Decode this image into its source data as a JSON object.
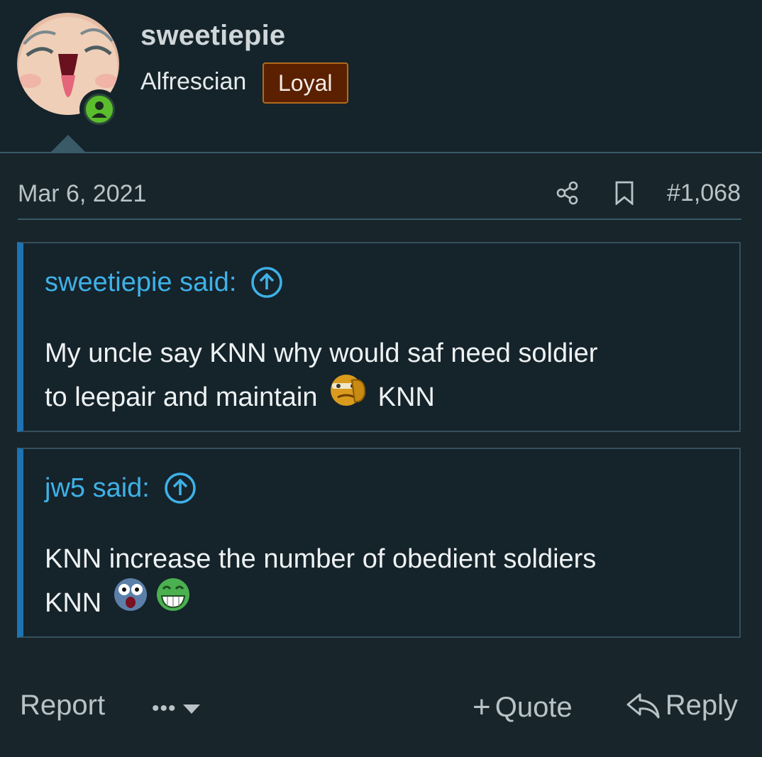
{
  "user": {
    "username": "sweetiepie",
    "title": "Alfrescian",
    "badge": "Loyal",
    "status": "online",
    "accent_online": "#5bbd2c"
  },
  "post": {
    "date": "Mar 6, 2021",
    "number": "#1,068",
    "icons": [
      "share-icon",
      "bookmark-icon"
    ]
  },
  "quotes": [
    {
      "author": "sweetiepie said:",
      "line1": "My uncle say KNN why would saf need soldier",
      "line2_before": "to leepair and maintain",
      "line2_after": "KNN",
      "smilies": [
        "facepalm-smilie"
      ]
    },
    {
      "author": "jw5 said:",
      "line1": "KNN increase the number of obedient soldiers",
      "line2_before": "KNN",
      "smilies": [
        "shocked-smilie",
        "grin-smilie"
      ]
    }
  ],
  "footer": {
    "report": "Report",
    "more": "•••",
    "quote": "Quote",
    "quote_prefix": "+",
    "reply": "Reply"
  },
  "colors": {
    "background": "#18252b",
    "header_background": "#15232b",
    "link": "#3fb1e6",
    "quote_border": "#1d73b3",
    "badge_background": "#5a2000",
    "badge_border": "#b26b1c"
  }
}
